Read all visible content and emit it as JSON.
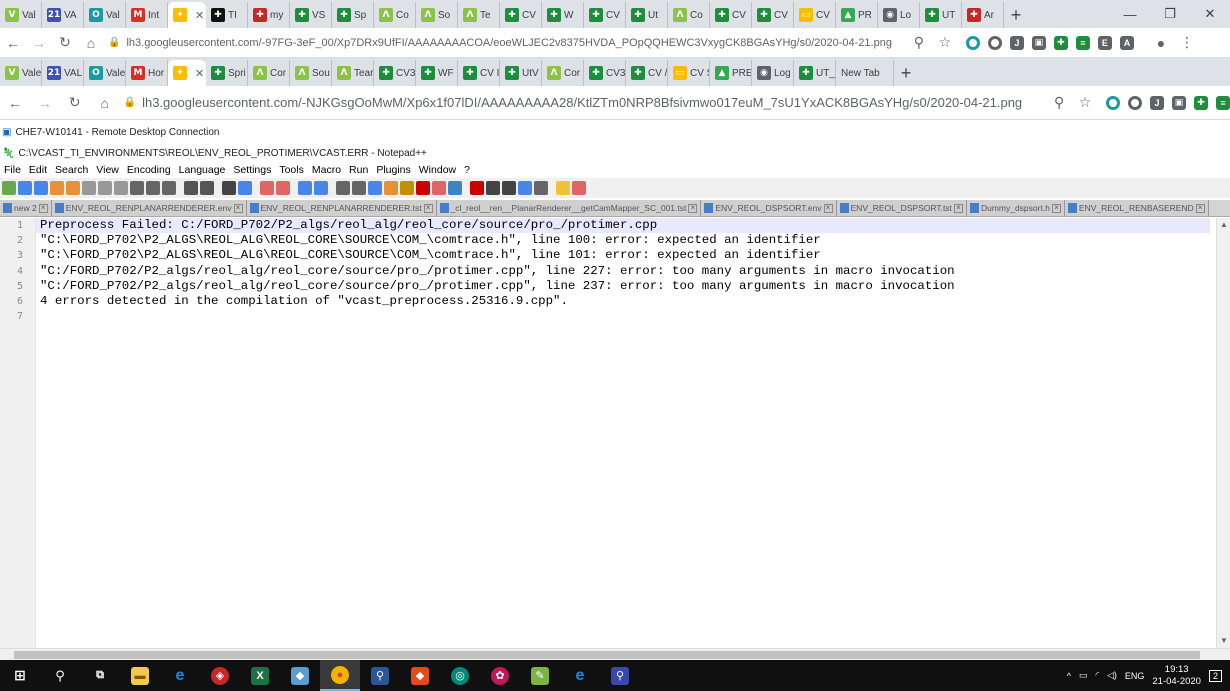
{
  "outer_tabs": [
    {
      "label": "Val",
      "icon": "V",
      "color": "#8bc34a",
      "active": false
    },
    {
      "label": "VA",
      "icon": "21",
      "color": "#3f51b5",
      "active": false
    },
    {
      "label": "Val",
      "icon": "O",
      "color": "#1a9ba1",
      "active": false
    },
    {
      "label": "Int",
      "icon": "M",
      "color": "#d93025",
      "active": false
    },
    {
      "label": "",
      "icon": "✦",
      "color": "#fbbc04",
      "active": true
    },
    {
      "label": "TI",
      "icon": "✚",
      "color": "#111111",
      "active": false
    },
    {
      "label": "my",
      "icon": "✚",
      "color": "#c62828",
      "active": false
    },
    {
      "label": "VS",
      "icon": "✚",
      "color": "#1e8e3e",
      "active": false
    },
    {
      "label": "Sp",
      "icon": "✚",
      "color": "#1e8e3e",
      "active": false
    },
    {
      "label": "Co",
      "icon": "Λ",
      "color": "#8bc34a",
      "active": false
    },
    {
      "label": "So",
      "icon": "Λ",
      "color": "#8bc34a",
      "active": false
    },
    {
      "label": "Te",
      "icon": "Λ",
      "color": "#8bc34a",
      "active": false
    },
    {
      "label": "CV",
      "icon": "✚",
      "color": "#1e8e3e",
      "active": false
    },
    {
      "label": "W",
      "icon": "✚",
      "color": "#1e8e3e",
      "active": false
    },
    {
      "label": "CV",
      "icon": "✚",
      "color": "#1e8e3e",
      "active": false
    },
    {
      "label": "Ut",
      "icon": "✚",
      "color": "#1e8e3e",
      "active": false
    },
    {
      "label": "Co",
      "icon": "Λ",
      "color": "#8bc34a",
      "active": false
    },
    {
      "label": "CV",
      "icon": "✚",
      "color": "#1e8e3e",
      "active": false
    },
    {
      "label": "CV",
      "icon": "✚",
      "color": "#1e8e3e",
      "active": false
    },
    {
      "label": "CV",
      "icon": "▭",
      "color": "#fbbc04",
      "active": false
    },
    {
      "label": "PR",
      "icon": "▲",
      "color": "#34a853",
      "active": false
    },
    {
      "label": "Lo",
      "icon": "◉",
      "color": "#5f6368",
      "active": false
    },
    {
      "label": "UT",
      "icon": "✚",
      "color": "#1e8e3e",
      "active": false
    },
    {
      "label": "Ar",
      "icon": "✚",
      "color": "#c62828",
      "active": false
    }
  ],
  "outer_url": "lh3.googleusercontent.com/-97FG-3eF_00/Xp7DRx9UfFI/AAAAAAAACOA/eoeWLJEC2v8375HVDA_POpQQHEWC3VxygCK8BGAsYHg/s0/2020-04-21.png",
  "inner_tabs": [
    {
      "label": "Vale",
      "icon": "V",
      "color": "#8bc34a",
      "active": false
    },
    {
      "label": "VAL",
      "icon": "21",
      "color": "#3f51b5",
      "active": false
    },
    {
      "label": "Vale",
      "icon": "O",
      "color": "#1a9ba1",
      "active": false
    },
    {
      "label": "Hor",
      "icon": "M",
      "color": "#d93025",
      "active": false
    },
    {
      "label": "",
      "icon": "✦",
      "color": "#fbbc04",
      "active": true
    },
    {
      "label": "Spri",
      "icon": "✚",
      "color": "#1e8e3e",
      "active": false
    },
    {
      "label": "Cor",
      "icon": "Λ",
      "color": "#8bc34a",
      "active": false
    },
    {
      "label": "Sou",
      "icon": "Λ",
      "color": "#8bc34a",
      "active": false
    },
    {
      "label": "Tear",
      "icon": "Λ",
      "color": "#8bc34a",
      "active": false
    },
    {
      "label": "CV3",
      "icon": "✚",
      "color": "#1e8e3e",
      "active": false
    },
    {
      "label": "WF",
      "icon": "✚",
      "color": "#1e8e3e",
      "active": false
    },
    {
      "label": "CV I",
      "icon": "✚",
      "color": "#1e8e3e",
      "active": false
    },
    {
      "label": "UtV",
      "icon": "✚",
      "color": "#1e8e3e",
      "active": false
    },
    {
      "label": "Cor",
      "icon": "Λ",
      "color": "#8bc34a",
      "active": false
    },
    {
      "label": "CV3",
      "icon": "✚",
      "color": "#1e8e3e",
      "active": false
    },
    {
      "label": "CV /",
      "icon": "✚",
      "color": "#1e8e3e",
      "active": false
    },
    {
      "label": "CV S",
      "icon": "▭",
      "color": "#fbbc04",
      "active": false
    },
    {
      "label": "PRE",
      "icon": "▲",
      "color": "#34a853",
      "active": false
    },
    {
      "label": "Log",
      "icon": "◉",
      "color": "#5f6368",
      "active": false
    },
    {
      "label": "UT_",
      "icon": "✚",
      "color": "#1e8e3e",
      "active": false
    },
    {
      "label": "New Tab",
      "icon": "",
      "color": "#dee1e6",
      "active": false
    }
  ],
  "inner_url": "lh3.googleusercontent.com/-NJKGsgOoMwM/Xp6x1f07lDI/AAAAAAAAA28/KtlZTm0NRP8Bfsivmwo017euM_7sU1YxACK8BGAsYHg/s0/2020-04-21.png",
  "rdp_title": "CHE7-W10141 - Remote Desktop Connection",
  "npp_title": "C:\\VCAST_TI_ENVIRONMENTS\\REOL\\ENV_REOL_PROTIMER\\VCAST.ERR - Notepad++",
  "menu": [
    "File",
    "Edit",
    "Search",
    "View",
    "Encoding",
    "Language",
    "Settings",
    "Tools",
    "Macro",
    "Run",
    "Plugins",
    "Window",
    "?"
  ],
  "doc_tabs": [
    "new 2",
    "ENV_REOL_RENPLANARRENDERER.env",
    "ENV_REOL_RENPLANARRENDERER.tst",
    "_cl_reol__ren__PlanarRenderer__getCamMapper_SC_001.tst",
    "ENV_REOL_DSPSORT.env",
    "ENV_REOL_DSPSORT.tst",
    "Dummy_dspsort.h",
    "ENV_REOL_RENBASEREND"
  ],
  "line_numbers": [
    "1",
    "2",
    "3",
    "4",
    "5",
    "6",
    "7"
  ],
  "lines": [
    "Preprocess Failed: C:/FORD_P702/P2_algs/reol_alg/reol_core/source/pro_/protimer.cpp",
    "\"C:\\FORD_P702\\P2_ALGS\\REOL_ALG\\REOL_CORE\\SOURCE\\COM_\\comtrace.h\", line 100: error: expected an identifier",
    "\"C:\\FORD_P702\\P2_ALGS\\REOL_ALG\\REOL_CORE\\SOURCE\\COM_\\comtrace.h\", line 101: error: expected an identifier",
    "\"C:/FORD_P702/P2_algs/reol_alg/reol_core/source/pro_/protimer.cpp\", line 227: error: too many arguments in macro invocation",
    "\"C:/FORD_P702/P2_algs/reol_alg/reol_core/source/pro_/protimer.cpp\", line 237: error: too many arguments in macro invocation",
    "4 errors detected in the compilation of \"vcast_preprocess.25316.9.cpp\".",
    ""
  ],
  "taskbar": {
    "lang": "ENG",
    "time": "19:13",
    "date": "21-04-2020",
    "notifications": "2"
  }
}
